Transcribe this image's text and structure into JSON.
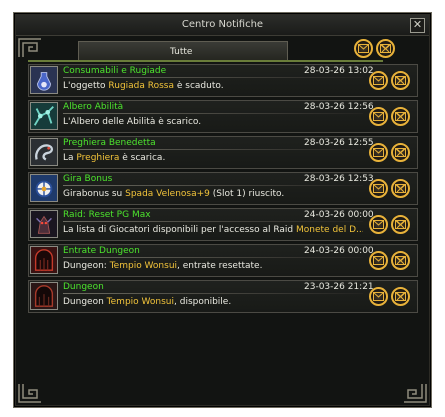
{
  "window": {
    "title": "Centro Notifiche"
  },
  "tabs": [
    {
      "label": "Tutte"
    }
  ],
  "notifications": [
    {
      "title": "Consumabili e Rugiade",
      "date": "28-03-26 13:02",
      "msg_pre": "L'oggetto ",
      "msg_hl": "Rugiada Rossa",
      "msg_post": " è scaduto."
    },
    {
      "title": "Albero Abilità",
      "date": "28-03-26 12:56",
      "msg_pre": "L'Albero delle Abilità è scarico.",
      "msg_hl": "",
      "msg_post": ""
    },
    {
      "title": "Preghiera Benedetta",
      "date": "28-03-26 12:55",
      "msg_pre": "La ",
      "msg_hl": "Preghiera",
      "msg_post": " è scarica."
    },
    {
      "title": "Gira Bonus",
      "date": "28-03-26 12:53",
      "msg_pre": "Girabonus su ",
      "msg_hl": "Spada Velenosa+9",
      "msg_post": " (Slot 1) riuscito."
    },
    {
      "title": "Raid: Reset PG Max",
      "date": "24-03-26 00:00",
      "msg_pre": "La lista di Giocatori disponibili per l'accesso al Raid ",
      "msg_hl": "Monete del D....",
      "msg_post": ""
    },
    {
      "title": "Entrate Dungeon",
      "date": "24-03-26 00:00",
      "msg_pre": "Dungeon: ",
      "msg_hl": "Tempio Wonsui",
      "msg_post": ", entrate resettate."
    },
    {
      "title": "Dungeon",
      "date": "23-03-26 21:21",
      "msg_pre": "Dungeon ",
      "msg_hl": "Tempio Wonsui",
      "msg_post": ", disponibile."
    }
  ]
}
